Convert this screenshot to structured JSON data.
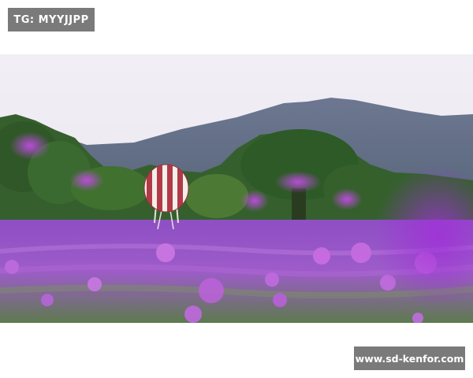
{
  "watermark_top": {
    "text": "TG: MYYJJPP"
  },
  "watermark_bottom": {
    "text": "www.sd-kenfor.com"
  },
  "photo": {
    "subject": "hot-air-balloon-in-verbena-flower-field",
    "colors": {
      "sky": "#ece8f2",
      "mountain": "#6c7790",
      "trees": "#3c6a34",
      "flowers": "#a35ccf",
      "balloon_red": "#b23a48",
      "balloon_white": "#f3efea"
    }
  }
}
